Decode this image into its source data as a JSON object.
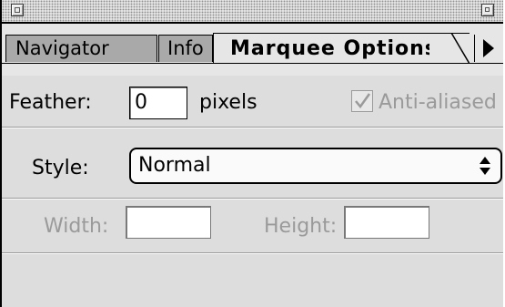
{
  "titlebar": {
    "close_icon": "close-box-icon",
    "zoom_icon": "zoom-box-icon"
  },
  "tabs": [
    {
      "label": "Navigator",
      "active": false
    },
    {
      "label": "Info",
      "active": false
    },
    {
      "label": "Marquee Options",
      "active": true
    }
  ],
  "tab_scroll_icon": "triangle-right-icon",
  "feather": {
    "label": "Feather:",
    "value": "0",
    "unit": "pixels"
  },
  "anti_aliased": {
    "label": "Anti-aliased",
    "checked": true,
    "enabled": false
  },
  "style": {
    "label": "Style:",
    "selected": "Normal",
    "icon": "updown-arrows-icon"
  },
  "size": {
    "width_label": "Width:",
    "width_value": "",
    "height_label": "Height:",
    "height_value": "",
    "enabled": false
  }
}
